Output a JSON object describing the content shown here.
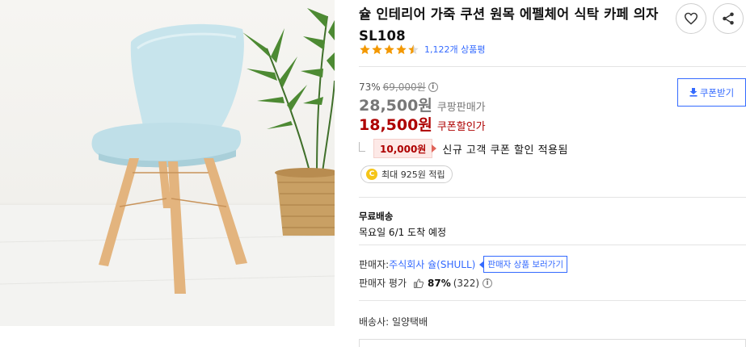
{
  "product": {
    "title": "슐 인테리어 가죽 쿠션 원목 에펠체어 식탁 카페 의자 SL108",
    "rating": 4.5,
    "review_text": "1,122개 상품평"
  },
  "price": {
    "discount_rate": "73%",
    "original_price": "69,000원",
    "coupang_price": "28,500원",
    "coupang_label": "쿠팡판매가",
    "coupon_price": "18,500원",
    "coupon_label": "쿠폰할인가",
    "coupon_button": "쿠폰받기",
    "new_customer_discount": "10,000원",
    "new_customer_text": "신규 고객 쿠폰 할인 적용됨",
    "cash_reward": "최대 925원 적립",
    "coin_symbol": "C"
  },
  "shipping": {
    "title": "무료배송",
    "arrival": "목요일 6/1 도착 예정",
    "carrier": "배송사: 일양택배"
  },
  "seller": {
    "label": "판매자: ",
    "name": "주식회사 슐(SHULL)",
    "link_label": "판매자 상품 보러가기",
    "eval_label": "판매자 평가",
    "eval_percent": "87%",
    "eval_count": "(322)"
  },
  "icons": {
    "wishlist": "heart-icon",
    "share": "share-icon",
    "download": "download-icon",
    "info": "info-icon",
    "thumb": "thumbs-up-icon"
  },
  "colors": {
    "accent_blue": "#346aff",
    "price_red": "#ae0000",
    "star_orange": "#f39800"
  }
}
